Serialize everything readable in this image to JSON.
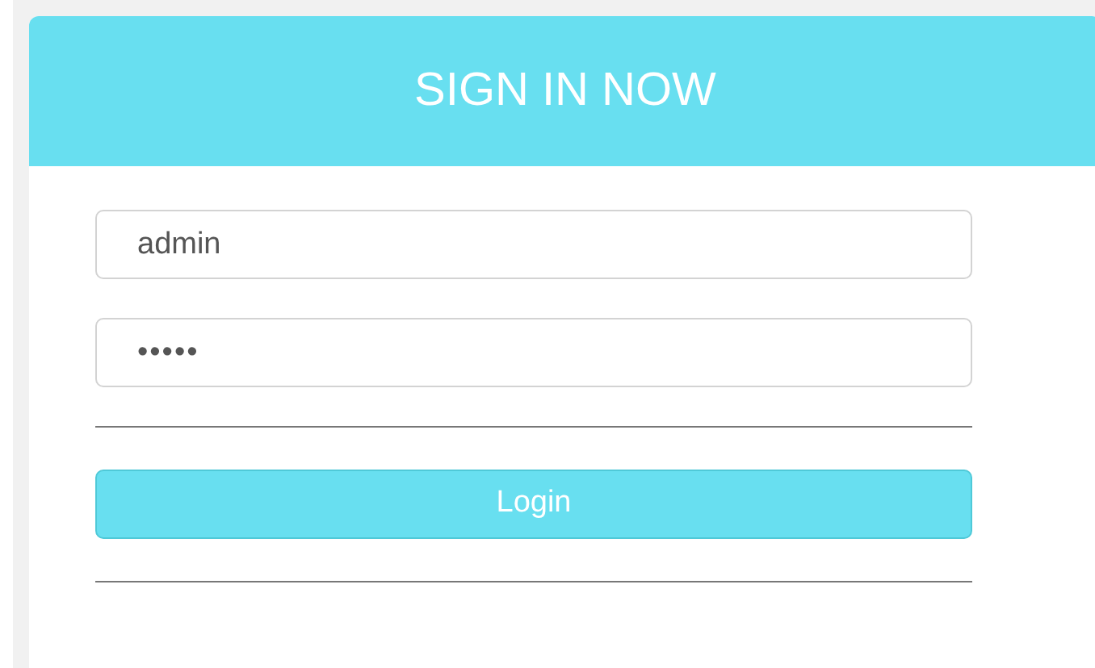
{
  "header": {
    "title": "SIGN IN NOW"
  },
  "fields": [
    {
      "kind": "text",
      "value": "admin"
    },
    {
      "kind": "password",
      "value": "•••••"
    }
  ],
  "login_button": {
    "label": "Login"
  }
}
